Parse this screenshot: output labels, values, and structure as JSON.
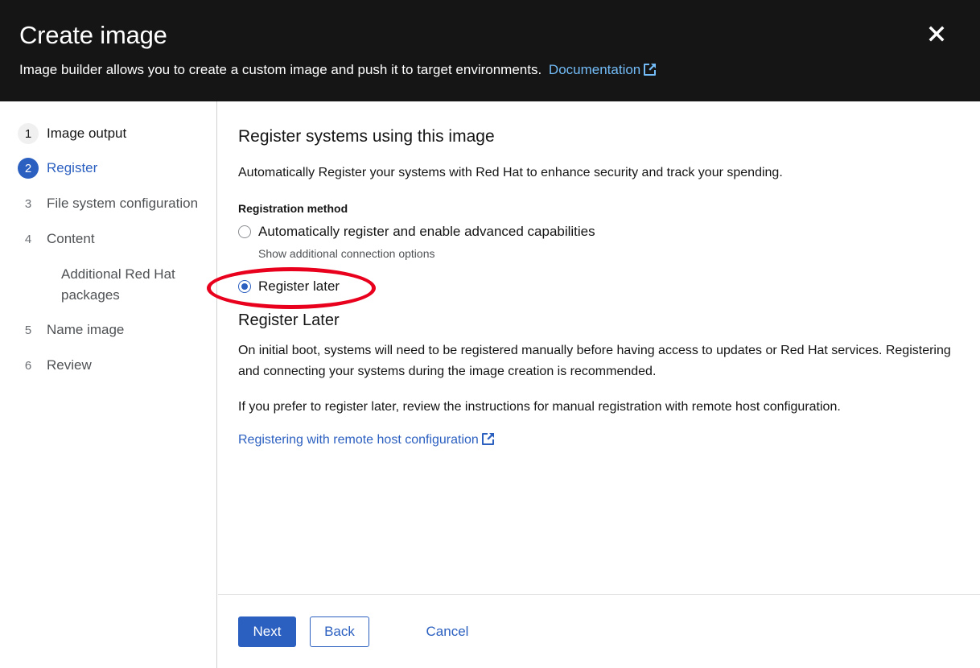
{
  "header": {
    "title": "Create image",
    "description": "Image builder allows you to create a custom image and push it to target environments.",
    "doc_link": "Documentation",
    "close_icon": "close-icon"
  },
  "nav": {
    "items": [
      {
        "num": "1",
        "label": "Image output",
        "state": "done"
      },
      {
        "num": "2",
        "label": "Register",
        "state": "current"
      },
      {
        "num": "3",
        "label": "File system configuration",
        "state": "disabled"
      },
      {
        "num": "4",
        "label": "Content",
        "state": "disabled"
      },
      {
        "num": "5",
        "label": "Name image",
        "state": "disabled"
      },
      {
        "num": "6",
        "label": "Review",
        "state": "disabled"
      }
    ],
    "sub_item": "Additional Red Hat packages"
  },
  "main": {
    "title": "Register systems using this image",
    "intro": "Automatically Register your systems with Red Hat to enhance security and track your spending.",
    "registration_label": "Registration method",
    "option_auto": "Automatically register and enable advanced capabilities",
    "option_auto_help": "Show additional connection options",
    "option_later": "Register later",
    "selected_option": "Register later",
    "later_title": "Register Later",
    "later_para1": "On initial boot, systems will need to be registered manually before having access to updates or Red Hat services. Registering and connecting your systems during the image creation is recommended.",
    "later_para2": "If you prefer to register later, review the instructions for manual registration with remote host configuration.",
    "remote_link": "Registering with remote host configuration"
  },
  "footer": {
    "next": "Next",
    "back": "Back",
    "cancel": "Cancel"
  },
  "colors": {
    "header_bg": "#151515",
    "accent": "#2b5fc0",
    "header_link": "#73bcf7",
    "highlight": "#e8001c"
  }
}
